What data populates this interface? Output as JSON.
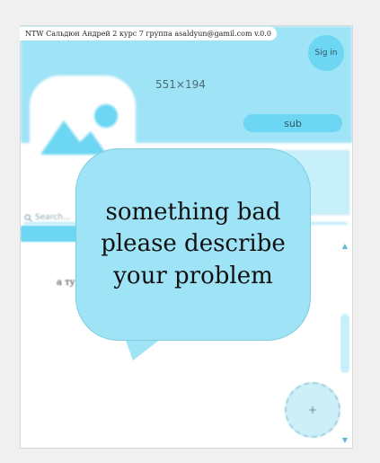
{
  "topbar": {
    "text": "NTW Сальдюн Андрей 2 курс 7 группа  asaldyun@gamil.com  v.0.0"
  },
  "header": {
    "signin_label": "Sig in",
    "size_text": "551×194",
    "sub_label": "sub"
  },
  "search": {
    "placeholder": "Search..."
  },
  "list": {
    "item_text": "a ту"
  },
  "fab": {
    "label": "+"
  },
  "bubble": {
    "lines": [
      "something bad",
      "please describe",
      "your problem"
    ]
  },
  "colors": {
    "accent": "#9ee3f6",
    "accent_dark": "#6dd6f2",
    "background": "#f0f0f0"
  },
  "icons": {
    "search": "search-icon",
    "image": "image-placeholder-icon",
    "scroll_up": "scroll-up-arrow-icon",
    "scroll_down": "scroll-down-arrow-icon"
  }
}
